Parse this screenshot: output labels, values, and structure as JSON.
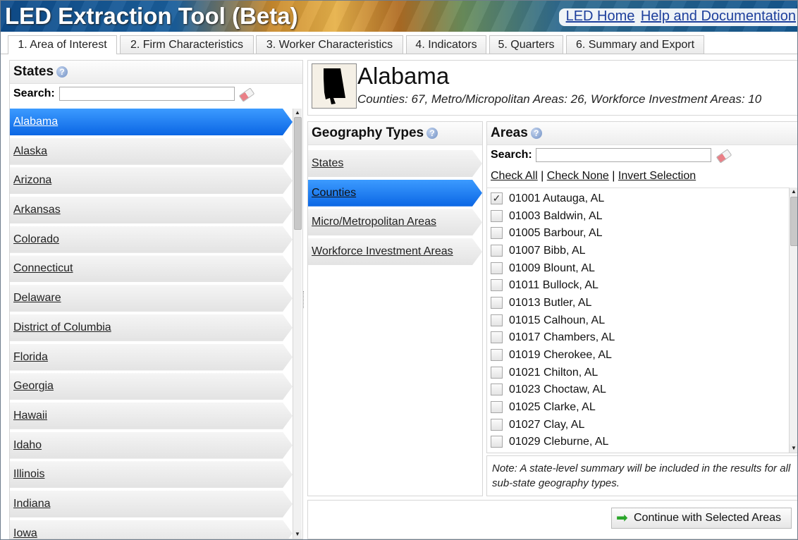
{
  "header": {
    "title": "LED Extraction Tool (Beta)",
    "links": [
      "LED Home",
      "Help and Documentation"
    ]
  },
  "tabs": [
    "1. Area of Interest",
    "2. Firm Characteristics",
    "3. Worker Characteristics",
    "4. Indicators",
    "5. Quarters",
    "6. Summary and Export"
  ],
  "active_tab": "1. Area of Interest",
  "states_panel": {
    "title": "States",
    "search_label": "Search:",
    "search_value": "",
    "selected": "Alabama",
    "items": [
      "Alabama",
      "Alaska",
      "Arizona",
      "Arkansas",
      "Colorado",
      "Connecticut",
      "Delaware",
      "District of Columbia",
      "Florida",
      "Georgia",
      "Hawaii",
      "Idaho",
      "Illinois",
      "Indiana",
      "Iowa"
    ]
  },
  "state_info": {
    "name": "Alabama",
    "summary": "Counties: 67, Metro/Micropolitan Areas: 26, Workforce Investment Areas: 10"
  },
  "geography_types": {
    "title": "Geography Types",
    "selected": "Counties",
    "items": [
      "States",
      "Counties",
      "Micro/Metropolitan Areas",
      "Workforce Investment Areas"
    ]
  },
  "areas_panel": {
    "title": "Areas",
    "search_label": "Search:",
    "search_value": "",
    "actions": {
      "check_all": "Check All",
      "check_none": "Check None",
      "invert": "Invert Selection",
      "separator": "|"
    },
    "items": [
      {
        "label": "01001 Autauga, AL",
        "checked": true
      },
      {
        "label": "01003 Baldwin, AL",
        "checked": false
      },
      {
        "label": "01005 Barbour, AL",
        "checked": false
      },
      {
        "label": "01007 Bibb, AL",
        "checked": false
      },
      {
        "label": "01009 Blount, AL",
        "checked": false
      },
      {
        "label": "01011 Bullock, AL",
        "checked": false
      },
      {
        "label": "01013 Butler, AL",
        "checked": false
      },
      {
        "label": "01015 Calhoun, AL",
        "checked": false
      },
      {
        "label": "01017 Chambers, AL",
        "checked": false
      },
      {
        "label": "01019 Cherokee, AL",
        "checked": false
      },
      {
        "label": "01021 Chilton, AL",
        "checked": false
      },
      {
        "label": "01023 Choctaw, AL",
        "checked": false
      },
      {
        "label": "01025 Clarke, AL",
        "checked": false
      },
      {
        "label": "01027 Clay, AL",
        "checked": false
      },
      {
        "label": "01029 Cleburne, AL",
        "checked": false
      }
    ],
    "note": "Note: A state-level summary will be included in the results for all sub-state geography types."
  },
  "continue_button": "Continue with Selected Areas",
  "colors": {
    "selected_blue": "#0b66e4",
    "link_blue": "#1d3f9c"
  }
}
